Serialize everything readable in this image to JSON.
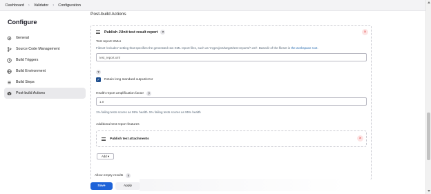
{
  "breadcrumb": [
    "Dashboard",
    "Validator",
    "Configuration"
  ],
  "sidebar": {
    "title": "Configure",
    "items": [
      {
        "label": "General",
        "icon": "gear-icon"
      },
      {
        "label": "Source Code Management",
        "icon": "branch-icon"
      },
      {
        "label": "Build Triggers",
        "icon": "clock-icon"
      },
      {
        "label": "Build Environment",
        "icon": "globe-icon"
      },
      {
        "label": "Build Steps",
        "icon": "list-icon"
      },
      {
        "label": "Post-build Actions",
        "icon": "box-icon"
      }
    ],
    "active_index": 5
  },
  "main": {
    "section_title": "Post-build Actions",
    "publisher": {
      "title": "Publish JUnit test result report",
      "test_report_label": "Test report XMLs",
      "test_report_desc_prefix": "Fileset 'includes' setting that specifies the generated raw XML report files, such as 'myproject/target/test-reports/*.xml'. Basedir of the fileset is ",
      "test_report_desc_link": "the workspace root",
      "test_report_desc_suffix": ".",
      "test_report_value": "test_report.xml",
      "retain_label": "Retain long standard output/error",
      "retain_checked": true,
      "health_label": "Health report amplification factor",
      "health_value": "1.0",
      "health_desc": "1% failing tests scores as 99% health. 5% failing tests scores as 95% health",
      "additional_label": "Additional test report features",
      "attachments_title": "Publish test attachments",
      "add_label": "Add ▾",
      "allow_empty_label": "Allow empty results"
    }
  },
  "footer": {
    "save_label": "Save",
    "apply_label": "Apply"
  },
  "colors": {
    "accent": "#1e63d8",
    "checkbox": "#1f4f8f",
    "link": "#2a6db0",
    "remove": "#d33333"
  }
}
